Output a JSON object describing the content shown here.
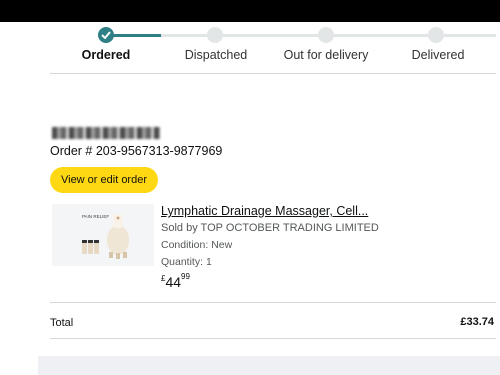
{
  "tracker": {
    "steps": [
      {
        "label": "Ordered",
        "done": true
      },
      {
        "label": "Dispatched",
        "done": false
      },
      {
        "label": "Out for delivery",
        "done": false
      },
      {
        "label": "Delivered",
        "done": false
      }
    ]
  },
  "order": {
    "number": "Order # 203-9567313-9877969",
    "edit_button": "View or edit order"
  },
  "product": {
    "title": "Lymphatic Drainage Massager, Cell...",
    "sold_by": "Sold by TOP OCTOBER TRADING LIMITED",
    "condition": "Condition: New",
    "quantity": "Quantity: 1",
    "price_currency": "£",
    "price_whole": "44",
    "price_fraction": "99",
    "image_icon": "product-thumbnail",
    "image_text": "PAIN RELIEF"
  },
  "total": {
    "label": "Total",
    "value": "£33.74"
  },
  "colors": {
    "accent": "#2f7f86",
    "button": "#ffd814"
  }
}
